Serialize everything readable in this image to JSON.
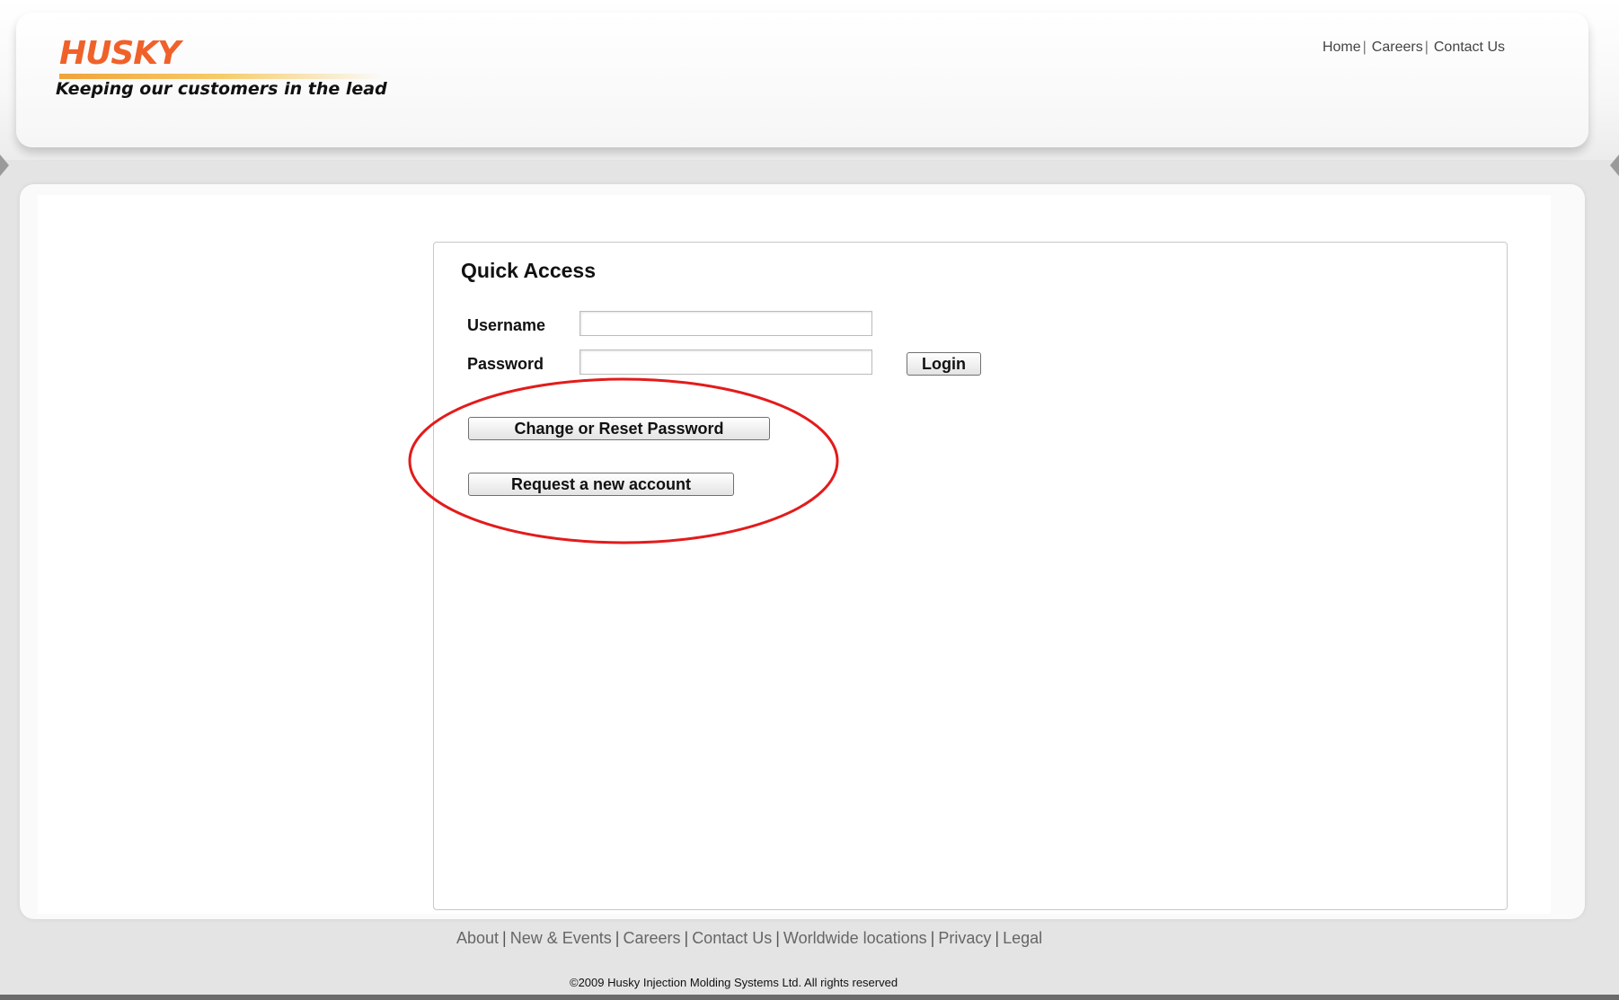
{
  "brand": {
    "logo_text": "HUSKY",
    "tagline": "Keeping our customers in the lead",
    "accent_color": "#f0612a"
  },
  "top_nav": {
    "items": [
      "Home",
      "Careers",
      "Contact Us"
    ],
    "separator": "|"
  },
  "login_panel": {
    "title": "Quick Access",
    "username_label": "Username",
    "username_value": "",
    "password_label": "Password",
    "password_value": "",
    "login_button": "Login",
    "change_password_button": "Change or Reset Password",
    "request_account_button": "Request a new account",
    "highlight_color": "#e31b1b"
  },
  "footer": {
    "links": [
      "About",
      "New & Events",
      "Careers",
      "Contact Us",
      "Worldwide locations",
      "Privacy",
      "Legal"
    ],
    "separator": "|",
    "copyright": "©2009 Husky Injection Molding Systems Ltd. All rights reserved"
  }
}
